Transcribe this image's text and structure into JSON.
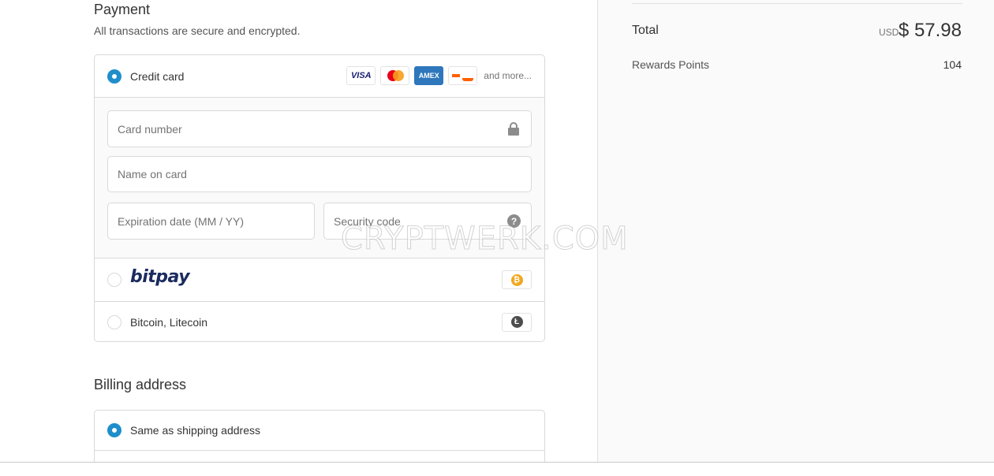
{
  "payment": {
    "title": "Payment",
    "subtitle": "All transactions are secure and encrypted.",
    "methods": {
      "credit_card": {
        "label": "Credit card",
        "selected": true,
        "cards": [
          "VISA",
          "Mastercard",
          "AMEX",
          "Discover"
        ],
        "more": "and more..."
      },
      "bitpay": {
        "label": "bitpay",
        "badge_icon": "bitcoin-icon"
      },
      "crypto": {
        "label": "Bitcoin, Litecoin",
        "badge_icon": "litecoin-icon"
      }
    },
    "fields": {
      "card_number": "Card number",
      "name_on_card": "Name on card",
      "expiration": "Expiration date (MM / YY)",
      "security_code": "Security code"
    }
  },
  "billing": {
    "title": "Billing address",
    "option_same": "Same as shipping address"
  },
  "summary": {
    "total_label": "Total",
    "currency": "USD",
    "total_value": "$ 57.98",
    "rewards_label": "Rewards Points",
    "rewards_value": "104"
  },
  "watermark": "CRYPTWERK.COM",
  "colors": {
    "accent": "#1f8ecb",
    "bitpay": "#1a2b5f",
    "bitcoin": "#f0a821"
  }
}
